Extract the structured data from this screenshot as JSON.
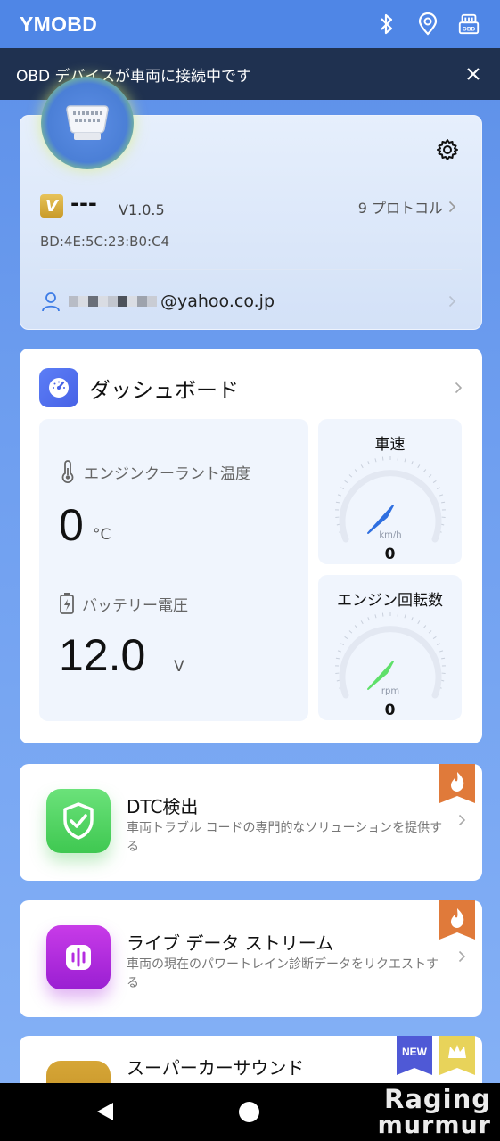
{
  "app_bar": {
    "title": "YMOBD",
    "icons": [
      "bluetooth-icon",
      "location-pin-icon",
      "obd-device-icon"
    ]
  },
  "banner": {
    "message": "OBD デバイスが車両に接続中です",
    "close_icon": "close-icon"
  },
  "device_card": {
    "vip_badge": "V",
    "user_name": "---",
    "version": "V1.0.5",
    "protocol_link": "9 プロトコル",
    "mac_address": "BD:4E:5C:23:B0:C4",
    "account_suffix": "@yahoo.co.jp"
  },
  "dashboard": {
    "title": "ダッシュボード",
    "coolant": {
      "label": "エンジンクーラント温度",
      "value": "0",
      "unit": "°C"
    },
    "battery": {
      "label": "バッテリー電圧",
      "value": "12.0",
      "unit": "V"
    },
    "speed_gauge": {
      "title": "車速",
      "unit": "km/h",
      "value": "0",
      "needle_color": "#2f6fe0"
    },
    "rpm_gauge": {
      "title": "エンジン回転数",
      "unit": "rpm",
      "value": "0",
      "needle_color": "#5fe06a"
    }
  },
  "features": [
    {
      "title": "DTC検出",
      "description": "車両トラブル コードの専門的なソリューションを提供する",
      "icon": "shield-check-icon",
      "badge": "hot-flame-ribbon"
    },
    {
      "title": "ライブ データ ストリーム",
      "description": "車両の現在のパワートレイン診断データをリクエストする",
      "icon": "waveform-icon",
      "badge": "hot-flame-ribbon"
    },
    {
      "title": "スーパーカーサウンド",
      "icon": "sound-icon",
      "badge_new": "NEW",
      "badge": "crown-ribbon"
    }
  ],
  "watermark": {
    "line1": "Raging",
    "line2": "murmur"
  },
  "colors": {
    "app_bar": "#4f86e6",
    "banner": "#1f3150",
    "accent_blue": "#5c7ef6",
    "hot_orange": "#e07a3a",
    "dtc_green": "#4ed35f",
    "stream_purple": "#b52ee0"
  }
}
